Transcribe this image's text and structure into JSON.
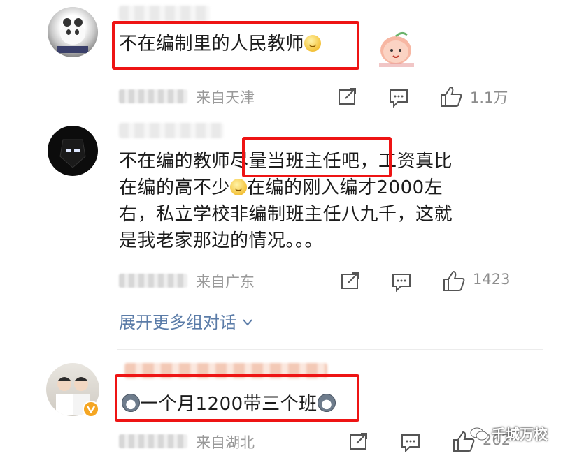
{
  "comments": [
    {
      "text": "不在编制里的人民教师",
      "location": "来自天津",
      "like_count": "1.1万"
    },
    {
      "text_line1": "不在编的教师尽量当班主任吧，工资真比",
      "text_line2": "在编的高不少",
      "text_line2b": "在编的刚入编才2000左",
      "text_line3": "右，私立学校非编制班主任八九千，这就",
      "text_line4": "是我老家那边的情况。。。",
      "location": "来自广东",
      "like_count": "1423",
      "expand_label": "展开更多组对话",
      "expand_icon": "chevron-down-icon"
    },
    {
      "text": "一个月1200带三个班",
      "location": "来自湖北",
      "like_count": "262"
    }
  ],
  "watermark": "千城万校",
  "colors": {
    "highlight": "#ee1414",
    "link": "#5b7ca8",
    "meta": "#9a9a9a"
  }
}
